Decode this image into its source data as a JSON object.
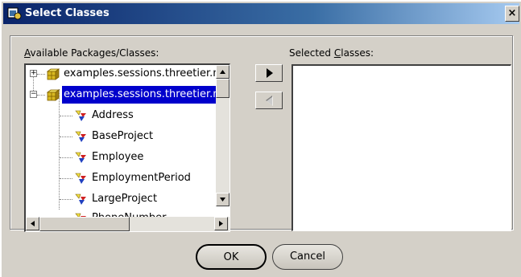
{
  "window": {
    "title": "Select Classes",
    "close_glyph": "×"
  },
  "available": {
    "label_hotkey": "A",
    "label_rest": "vailable Packages/Classes:",
    "tree": [
      {
        "kind": "package",
        "label": "examples.sessions.threetier.model",
        "expanded": false,
        "selected": false
      },
      {
        "kind": "package",
        "label": "examples.sessions.threetier.model",
        "expanded": true,
        "selected": true
      },
      {
        "kind": "class",
        "label": "Address"
      },
      {
        "kind": "class",
        "label": "BaseProject"
      },
      {
        "kind": "class",
        "label": "Employee"
      },
      {
        "kind": "class",
        "label": "EmploymentPeriod"
      },
      {
        "kind": "class",
        "label": "LargeProject"
      },
      {
        "kind": "class",
        "label": "PhoneNumber"
      }
    ]
  },
  "selected": {
    "label_prefix": "Selected ",
    "label_hotkey": "C",
    "label_rest": "lasses:",
    "items": []
  },
  "buttons": {
    "add_icon": "arrow-right-icon",
    "remove_icon": "arrow-left-icon",
    "ok": "OK",
    "cancel": "Cancel"
  },
  "colors": {
    "titlebar_start": "#0a246a",
    "selection": "#0000cc",
    "dialog_bg": "#d4d0c8"
  }
}
